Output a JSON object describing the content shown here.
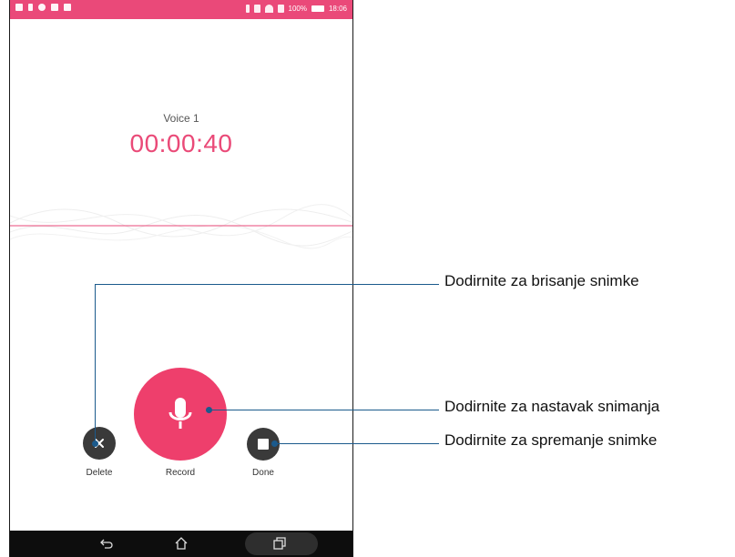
{
  "status_bar": {
    "battery": "100%",
    "time": "18:06"
  },
  "recorder": {
    "name": "Voice 1",
    "elapsed": "00:00:40"
  },
  "controls": {
    "delete_label": "Delete",
    "record_label": "Record",
    "done_label": "Done"
  },
  "callouts": {
    "delete": "Dodirnite za brisanje snimke",
    "record": "Dodirnite za nastavak snimanja",
    "done": "Dodirnite za spremanje snimke"
  },
  "colors": {
    "accent": "#ea4979",
    "record": "#ee3f6c",
    "dark_button": "#3a3a3a",
    "callout": "#1b5a8c"
  }
}
